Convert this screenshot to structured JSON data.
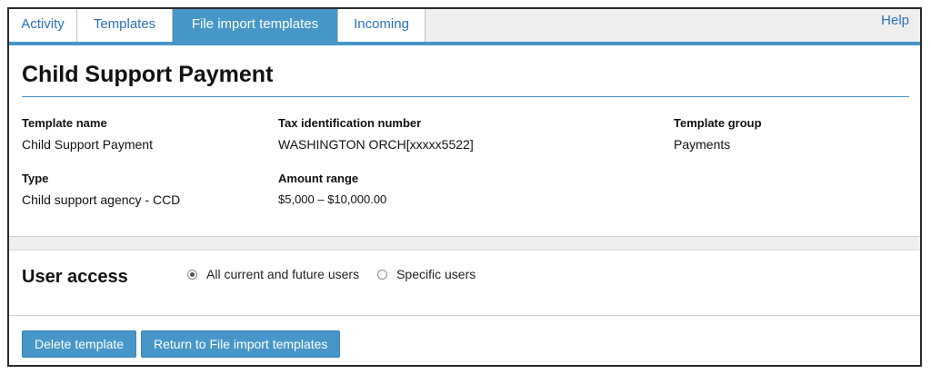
{
  "tabs": [
    {
      "label": "Activity",
      "active": false
    },
    {
      "label": "Templates",
      "active": false
    },
    {
      "label": "File import templates",
      "active": true
    },
    {
      "label": "Incoming",
      "active": false
    }
  ],
  "help_label": "Help",
  "page_title": "Child Support Payment",
  "details": {
    "template_name": {
      "label": "Template name",
      "value": "Child Support Payment"
    },
    "tax_id": {
      "label": "Tax identification number",
      "value": "WASHINGTON ORCH[xxxxx5522]"
    },
    "template_group": {
      "label": "Template group",
      "value": "Payments"
    },
    "type": {
      "label": "Type",
      "value": "Child support agency - CCD"
    },
    "amount_range": {
      "label": "Amount range",
      "value": "$5,000 – $10,000.00"
    }
  },
  "user_access": {
    "heading": "User access",
    "options": [
      {
        "label": "All current and future users",
        "selected": true
      },
      {
        "label": "Specific users",
        "selected": false
      }
    ]
  },
  "actions": {
    "delete_label": "Delete template",
    "return_label": "Return to File import templates"
  },
  "colors": {
    "accent": "#4796c8",
    "link": "#2a72b8",
    "tabbar_bg": "#eeeeee"
  }
}
